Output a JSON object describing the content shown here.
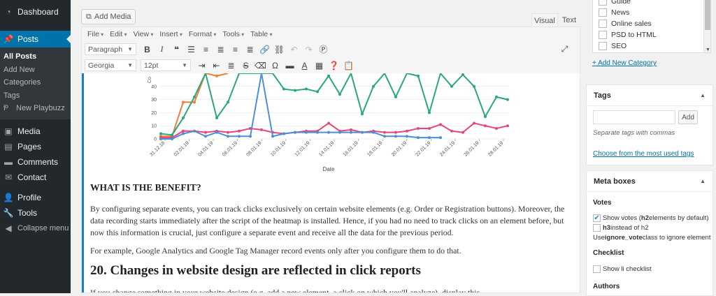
{
  "admin_menu": {
    "dashboard": "Dashboard",
    "posts": "Posts",
    "posts_submenu": [
      "All Posts",
      "Add New",
      "Categories",
      "Tags"
    ],
    "playbuzz": "New Playbuzz",
    "media": "Media",
    "pages": "Pages",
    "comments": "Comments",
    "contact": "Contact",
    "profile": "Profile",
    "tools": "Tools",
    "collapse": "Collapse menu"
  },
  "editor": {
    "add_media": "Add Media",
    "tab_visual": "Visual",
    "tab_text": "Text",
    "menubar": [
      "File",
      "Edit",
      "View",
      "Insert",
      "Format",
      "Tools",
      "Table"
    ],
    "format_select": "Paragraph",
    "font_select": "Georgia",
    "size_select": "12pt"
  },
  "content": {
    "heading_benefit": "WHAT IS THE BENEFIT?",
    "para1": "By configuring separate events, you can track clicks exclusively on certain website elements (e.g. Order or Registration buttons). Moreover, the data recording starts immediately after the script of the heatmap is installed. Hence, if you had no need to track clicks on an element before, but now this information is crucial, just configure a separate event and receive all the data for the previous period.",
    "para2": "For example, Google Analytics and Google Tag Manager record events only after you configure them to do that.",
    "heading_20": "20. Changes in website design are reflected in click reports",
    "para3": "If you change something in your website design (e.g. add a new element, a click on which you'll analyze), display this"
  },
  "chart_data": {
    "type": "line",
    "xlabel": "Date",
    "ylabel": "Co",
    "yticks": [
      0,
      10,
      20,
      30,
      40
    ],
    "ylim": [
      0,
      50
    ],
    "x_tick_labels": [
      "31.12.18",
      "02.01.19",
      "04.01.19",
      "06.01.19",
      "08.01.19",
      "10.01.19",
      "12.01.19",
      "14.01.19",
      "16.01.19",
      "18.01.19",
      "20.01.19",
      "22.01.19",
      "24.01.19",
      "26.01.19",
      "28.01.19"
    ],
    "series": [
      {
        "color": "#f07d3a",
        "values": [
          2,
          2,
          28,
          28,
          50,
          48,
          50
        ]
      },
      {
        "color": "#2aa876",
        "values": [
          4,
          3,
          16,
          32,
          50,
          16,
          28,
          50,
          50,
          50,
          50,
          38,
          37,
          38,
          36,
          48,
          34,
          50,
          19,
          40,
          50,
          32,
          50,
          48,
          20,
          50,
          40,
          49,
          40,
          17,
          32,
          30
        ]
      },
      {
        "color": "#e8457a",
        "values": [
          1,
          1,
          6,
          6,
          5,
          6,
          5,
          6,
          8,
          7,
          5,
          4,
          5,
          6,
          6,
          12,
          6,
          7,
          5,
          6,
          5,
          5,
          6,
          8,
          8,
          11,
          6,
          5,
          12,
          10,
          8,
          10
        ]
      },
      {
        "color": "#4c8fd6",
        "values": [
          0,
          0,
          4,
          6,
          2,
          5,
          2,
          2,
          2,
          50,
          2,
          4,
          5,
          5,
          5,
          5,
          5,
          5,
          5,
          5,
          2,
          2,
          2,
          1,
          1,
          1
        ]
      }
    ]
  },
  "categories": {
    "items": [
      {
        "label": "Guide",
        "checked": false
      },
      {
        "label": "News",
        "checked": false
      },
      {
        "label": "Online sales",
        "checked": false
      },
      {
        "label": "PSD to HTML",
        "checked": false
      },
      {
        "label": "SEO",
        "checked": false
      }
    ],
    "add_link": "+ Add New Category"
  },
  "tags": {
    "title": "Tags",
    "add_button": "Add",
    "hint": "Separate tags with commas",
    "choose_link": "Choose from the most used tags"
  },
  "meta_boxes": {
    "title": "Meta boxes",
    "votes_title": "Votes",
    "show_votes_prefix": "Show votes (",
    "show_votes_bold": "h2",
    "show_votes_suffix": " elements by default)",
    "h3_bold": "h3",
    "h3_suffix": " instead of h2",
    "use_prefix": "Use ",
    "use_bold": "ignore_vote",
    "use_suffix": " class to ignore element",
    "checklist_title": "Checklist",
    "show_li": "Show li checklist",
    "authors_title": "Authors"
  }
}
